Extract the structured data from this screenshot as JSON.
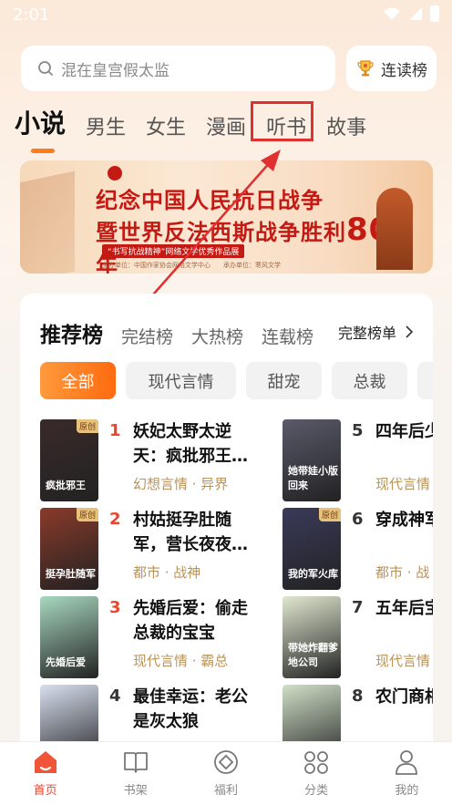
{
  "status": {
    "time": "2:01"
  },
  "search": {
    "placeholder": "混在皇宫假太监"
  },
  "rank_button": {
    "label": "连读榜"
  },
  "tabs": [
    "小说",
    "男生",
    "女生",
    "漫画",
    "听书",
    "故事"
  ],
  "banner": {
    "line1": "纪念中国人民抗日战争",
    "line2_prefix": "暨世界反法西斯战争胜利",
    "line2_number": "80",
    "line2_suffix": "周年",
    "badge": "“书写抗战精神”网络文学优秀作品展",
    "footer": "主办单位：中国作家协会网络文学中心　　承办单位：寒风文学"
  },
  "recommend": {
    "tabs": [
      "推荐榜",
      "完结榜",
      "大热榜",
      "连载榜"
    ],
    "full_list": "完整榜单",
    "chips": [
      "全部",
      "现代言情",
      "甜宠",
      "总裁"
    ],
    "books": [
      {
        "rank": "1",
        "title": "妖妃太野太逆天：疯批邪王…",
        "category": "幻想言情 · 异界",
        "cover_text": "疯批邪王",
        "tag": "原创",
        "color": "#3a2a2a"
      },
      {
        "rank": "2",
        "title": "村姑挺孕肚随军，营长夜夜…",
        "category": "都市 · 战神",
        "cover_text": "挺孕肚随军",
        "tag": "原创",
        "color": "#8a3a2a"
      },
      {
        "rank": "3",
        "title": "先婚后爱：偷走总裁的宝宝",
        "category": "现代言情 · 霸总",
        "cover_text": "先婚后爱",
        "tag": "",
        "color": "#a8d8c0"
      },
      {
        "rank": "4",
        "title": "最佳幸运：老公是灰太狼",
        "category": "",
        "cover_text": "",
        "tag": "",
        "color": "#d8e0f0"
      },
      {
        "rank": "5",
        "title": "四年后少缩小",
        "category": "现代言情",
        "cover_text": "她带娃小版回来",
        "tag": "",
        "color": "#5a5a6a"
      },
      {
        "rank": "6",
        "title": "穿成神军火库",
        "category": "都市 · 战",
        "cover_text": "我的军火库",
        "tag": "原创",
        "color": "#3a3a5a"
      },
      {
        "rank": "7",
        "title": "五年后宝带她",
        "category": "现代言情",
        "cover_text": "带她炸翻爹地公司",
        "tag": "",
        "color": "#e0e8d0"
      },
      {
        "rank": "8",
        "title": "农门商相公赖",
        "category": "",
        "cover_text": "",
        "tag": "",
        "color": "#d0e0c8"
      }
    ]
  },
  "bottom_nav": [
    {
      "label": "首页",
      "icon": "home-icon"
    },
    {
      "label": "书架",
      "icon": "book-icon"
    },
    {
      "label": "福利",
      "icon": "gift-icon"
    },
    {
      "label": "分类",
      "icon": "category-icon"
    },
    {
      "label": "我的",
      "icon": "user-icon"
    }
  ],
  "colors": {
    "accent": "#ff7b1c",
    "active_nav": "#e8472f",
    "rank_red": "#e8472f",
    "rank_gray": "#333333"
  }
}
